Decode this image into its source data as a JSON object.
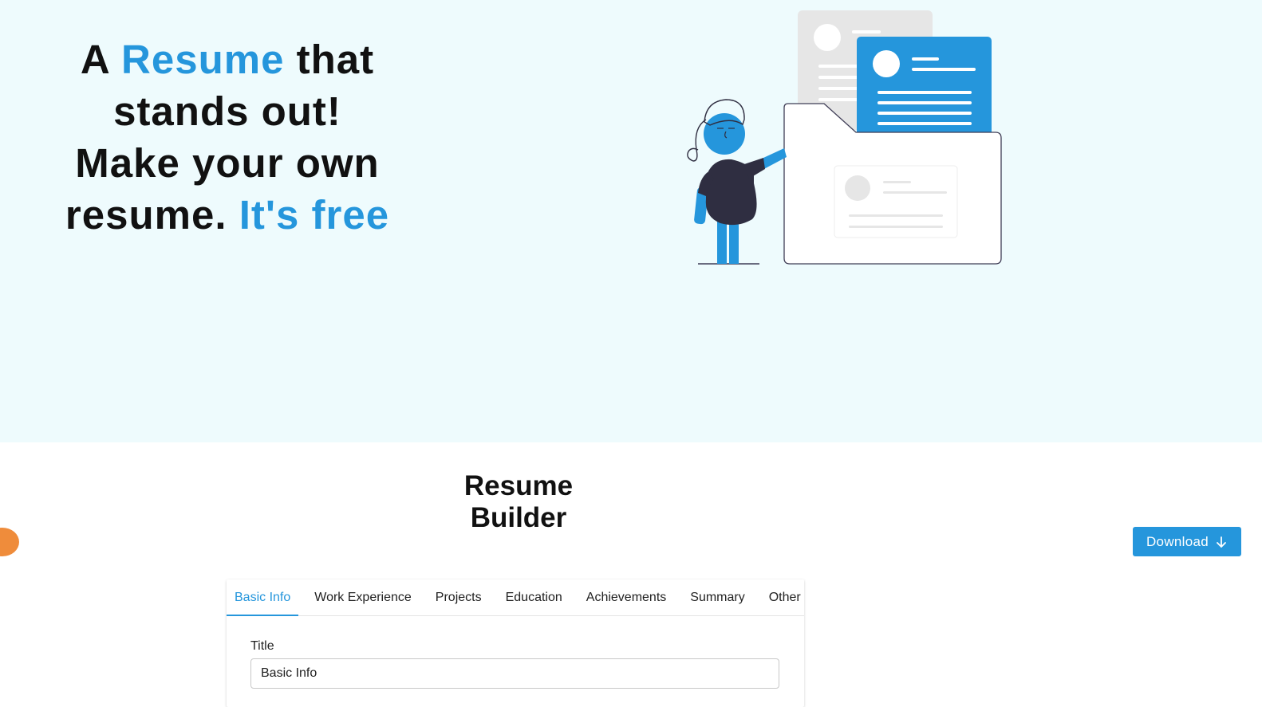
{
  "hero": {
    "line1_a": "A ",
    "line1_b": "Resume",
    "line1_c": " that",
    "line2": "stands out!",
    "line3": "Make your own",
    "line4_a": "resume. ",
    "line4_b": "It's free"
  },
  "builder": {
    "title": "Resume Builder",
    "download_label": "Download"
  },
  "tabs": [
    {
      "label": "Basic Info",
      "active": true
    },
    {
      "label": "Work Experience"
    },
    {
      "label": "Projects"
    },
    {
      "label": "Education"
    },
    {
      "label": "Achievements"
    },
    {
      "label": "Summary"
    },
    {
      "label": "Other"
    }
  ],
  "form": {
    "title_label": "Title",
    "title_value": "Basic Info"
  },
  "colors": {
    "accent": "#2596dc",
    "hero_bg": "#eefbfd",
    "figure_dark": "#2f2e41",
    "dot": "#ef8c3b"
  },
  "icons": {
    "download": "arrow-down-icon"
  }
}
